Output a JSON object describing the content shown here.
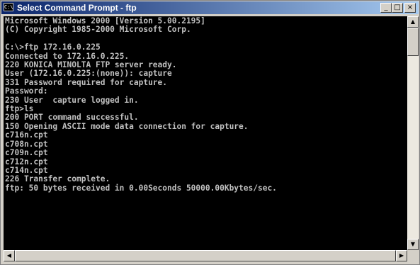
{
  "window": {
    "title": "Select Command Prompt - ftp",
    "icon_text": "C:\\",
    "controls": {
      "minimize": "_",
      "maximize": "□",
      "close": "×"
    }
  },
  "console": {
    "lines": [
      "Microsoft Windows 2000 [Version 5.00.2195]",
      "(C) Copyright 1985-2000 Microsoft Corp.",
      "",
      "C:\\>ftp 172.16.0.225",
      "Connected to 172.16.0.225.",
      "220 KONICA MINOLTA FTP server ready.",
      "User (172.16.0.225:(none)): capture",
      "331 Password required for capture.",
      "Password:",
      "230 User  capture logged in.",
      "ftp>ls",
      "200 PORT command successful.",
      "150 Opening ASCII mode data connection for capture.",
      "c716n.cpt",
      "c708n.cpt",
      "c709n.cpt",
      "c712n.cpt",
      "c714n.cpt",
      "226 Transfer complete.",
      "ftp: 50 bytes received in 0.00Seconds 50000.00Kbytes/sec."
    ]
  },
  "scrollbars": {
    "up_arrow": "▲",
    "down_arrow": "▼",
    "left_arrow": "◀",
    "right_arrow": "▶"
  },
  "colors": {
    "titlebar_start": "#0a246a",
    "titlebar_end": "#a6caf0",
    "console_bg": "#000000",
    "console_fg": "#c0c0c0"
  }
}
